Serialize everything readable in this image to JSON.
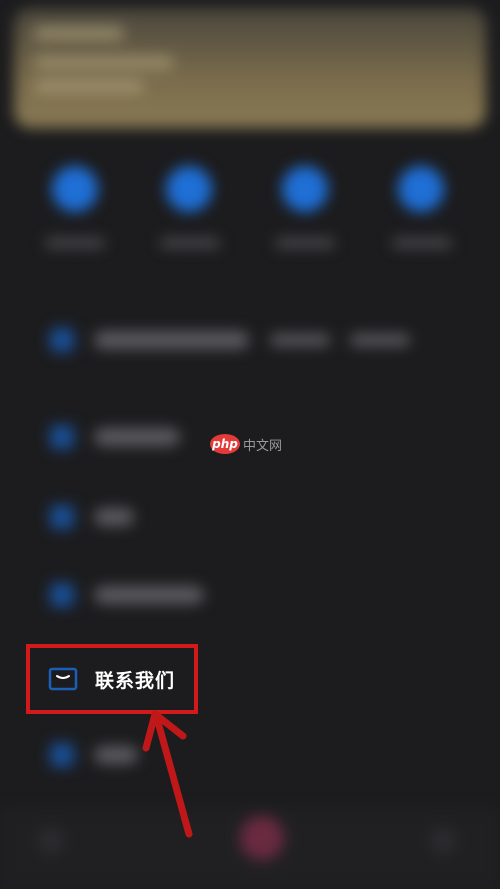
{
  "menu": {
    "highlighted_item": {
      "label": "联系我们",
      "icon": "message-box-icon"
    }
  },
  "watermark": {
    "logo_text": "php",
    "text": "中文网"
  },
  "colors": {
    "background": "#1c1c1e",
    "highlight_border": "#d11a1a",
    "arrow": "#c01818",
    "icon_blue": "#1a5fb8",
    "label": "#ffffff"
  }
}
